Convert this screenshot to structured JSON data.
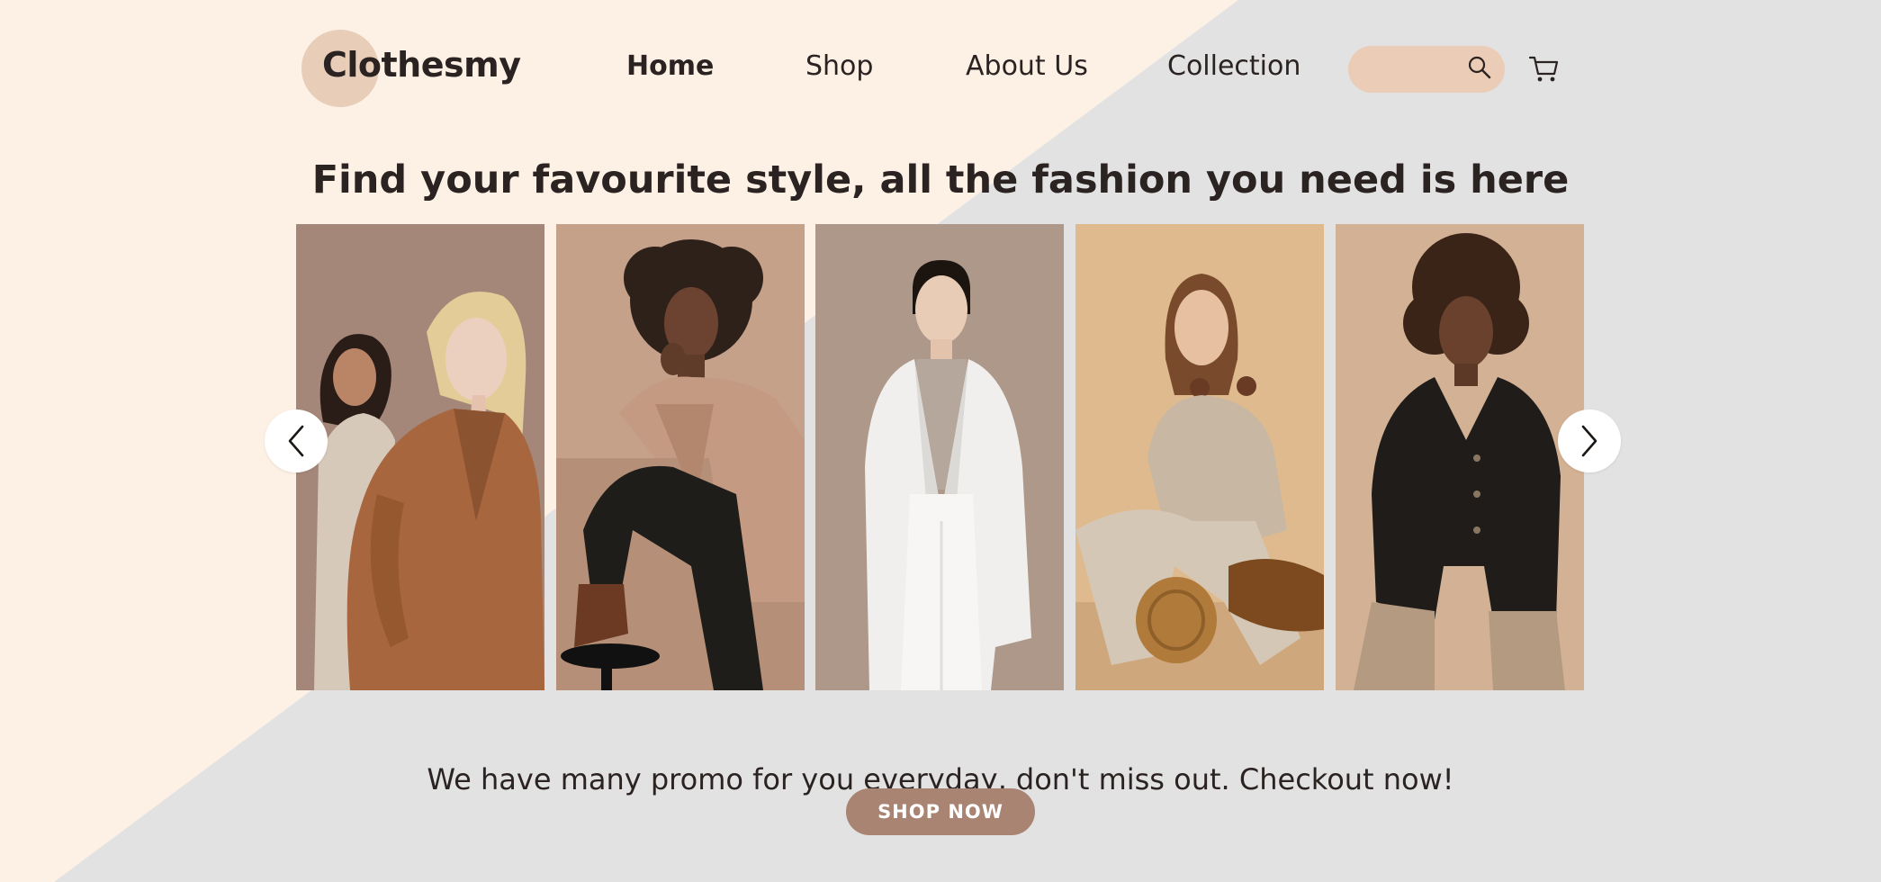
{
  "brand": {
    "name": "Clothesmy"
  },
  "nav": {
    "items": [
      {
        "label": "Home",
        "active": true
      },
      {
        "label": "Shop",
        "active": false
      },
      {
        "label": "About Us",
        "active": false
      },
      {
        "label": "Collection",
        "active": false
      }
    ]
  },
  "search": {
    "placeholder": "",
    "value": "",
    "icon": "search-icon"
  },
  "cart": {
    "icon": "cart-icon"
  },
  "hero": {
    "headline": "Find your favourite style, all the fashion you need is here"
  },
  "gallery": {
    "photos": [
      {
        "name": "photo-two-women-coats"
      },
      {
        "name": "photo-woman-curly-hair-beige-blazer"
      },
      {
        "name": "photo-woman-white-suit"
      },
      {
        "name": "photo-woman-knit-outfit-basket"
      },
      {
        "name": "photo-woman-black-jacket"
      }
    ],
    "prev_icon": "chevron-left-icon",
    "next_icon": "chevron-right-icon"
  },
  "promo": {
    "text": "We have many promo for you everyday, don't miss out. Checkout now!",
    "button_label": "SHOP NOW"
  },
  "colors": {
    "accent": "#a98473",
    "search_bg": "#ebcdb7",
    "logo_circle": "#e8cdb9",
    "bg_light": "#fdf1e5",
    "bg_gray": "#e2e2e2"
  }
}
